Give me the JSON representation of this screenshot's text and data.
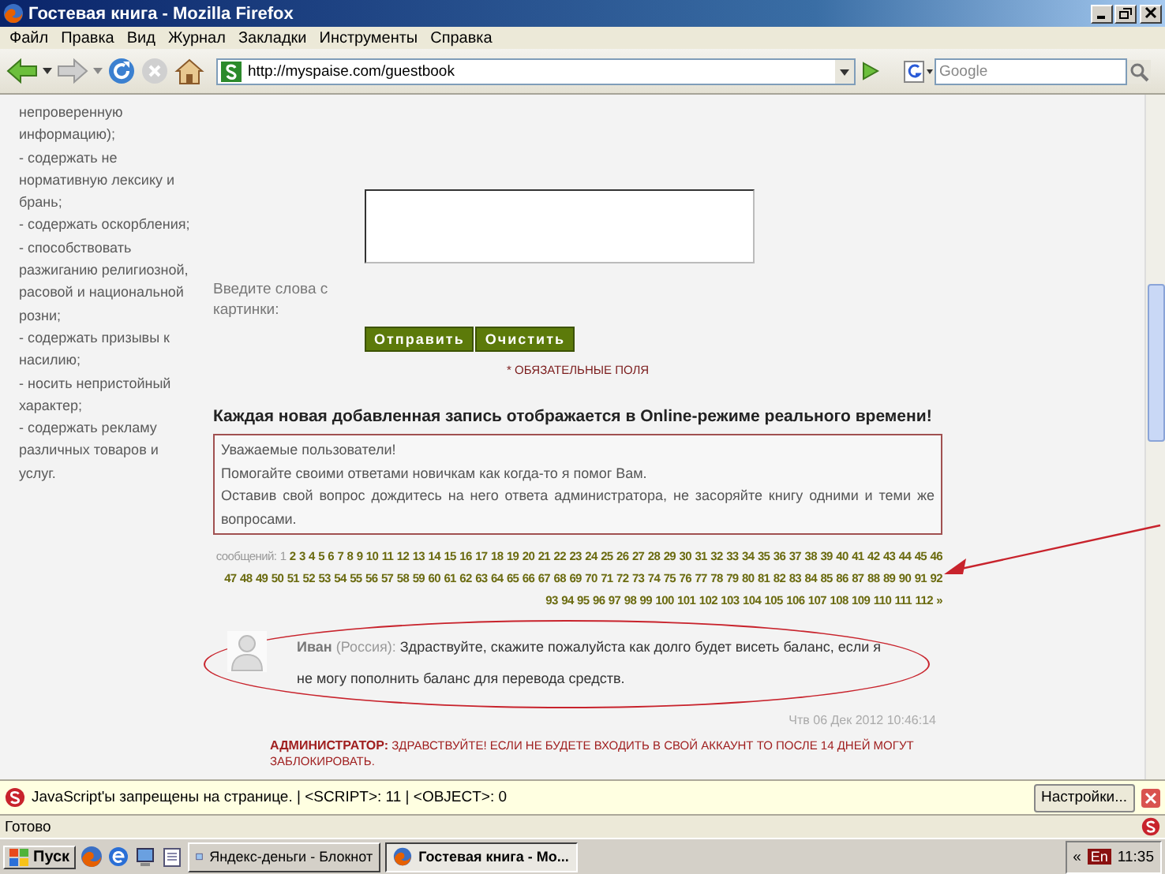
{
  "window": {
    "title": "Гостевая книга - Mozilla Firefox"
  },
  "menu": [
    "Файл",
    "Правка",
    "Вид",
    "Журнал",
    "Закладки",
    "Инструменты",
    "Справка"
  ],
  "navigation": {
    "address": "http://myspaise.com/guestbook",
    "search_placeholder": "Google"
  },
  "sidebar": {
    "rules": [
      "непроверенную информацию);",
      "- содержать не нормативную лексику и брань;",
      "- содержать оскорбления;",
      "- способствовать разжиганию религиозной, расовой и национальной розни;",
      "- содержать призывы к насилию;",
      "- носить непристойный характер;",
      "- содержать рекламу различных товаров и услуг."
    ]
  },
  "form": {
    "captcha_label": "Введите слова с картинки:",
    "buttons": [
      "Отправить",
      "Очистить"
    ],
    "required_note": "* ОБЯЗАТЕЛЬНЫЕ ПОЛЯ"
  },
  "heading": "Каждая новая добавленная запись отображается в Online-режиме реального времени!",
  "notice": [
    "Уважаемые пользователи!",
    "Помогайте своими ответами новичкам как когда-то я помог Вам.",
    "Оставив свой вопрос дождитесь на него ответа администратора, не засоряйте книгу одними и теми же вопросами."
  ],
  "pagination": {
    "label": "сообщений:",
    "pages": [
      {
        "label": "1",
        "selected": true
      },
      {
        "label": "2",
        "selected": false
      },
      {
        "label": "3",
        "selected": false
      },
      {
        "label": "4",
        "selected": false
      },
      {
        "label": "5",
        "selected": false
      },
      {
        "label": "6",
        "selected": false
      },
      {
        "label": "7",
        "selected": false
      },
      {
        "label": "8",
        "selected": false
      },
      {
        "label": "9",
        "selected": false
      },
      {
        "label": "10",
        "selected": false
      },
      {
        "label": "11",
        "selected": false
      },
      {
        "label": "12",
        "selected": false
      },
      {
        "label": "13",
        "selected": false
      },
      {
        "label": "14",
        "selected": false
      },
      {
        "label": "15",
        "selected": false
      },
      {
        "label": "16",
        "selected": false
      },
      {
        "label": "17",
        "selected": false
      },
      {
        "label": "18",
        "selected": false
      },
      {
        "label": "19",
        "selected": false
      },
      {
        "label": "20",
        "selected": false
      },
      {
        "label": "21",
        "selected": false
      },
      {
        "label": "22",
        "selected": false
      },
      {
        "label": "23",
        "selected": false
      },
      {
        "label": "24",
        "selected": false
      },
      {
        "label": "25",
        "selected": false
      },
      {
        "label": "26",
        "selected": false
      },
      {
        "label": "27",
        "selected": false
      },
      {
        "label": "28",
        "selected": false
      },
      {
        "label": "29",
        "selected": false
      },
      {
        "label": "30",
        "selected": false
      },
      {
        "label": "31",
        "selected": false
      },
      {
        "label": "32",
        "selected": false
      },
      {
        "label": "33",
        "selected": false
      },
      {
        "label": "34",
        "selected": false
      },
      {
        "label": "35",
        "selected": false
      },
      {
        "label": "36",
        "selected": false
      },
      {
        "label": "37",
        "selected": false
      },
      {
        "label": "38",
        "selected": false
      },
      {
        "label": "39",
        "selected": false
      },
      {
        "label": "40",
        "selected": false
      },
      {
        "label": "41",
        "selected": false
      },
      {
        "label": "42",
        "selected": false
      },
      {
        "label": "43",
        "selected": false
      },
      {
        "label": "44",
        "selected": false
      },
      {
        "label": "45",
        "selected": false
      },
      {
        "label": "46",
        "selected": false
      },
      {
        "label": "47",
        "selected": false
      },
      {
        "label": "48",
        "selected": false
      },
      {
        "label": "49",
        "selected": false
      },
      {
        "label": "50",
        "selected": false
      },
      {
        "label": "51",
        "selected": false
      },
      {
        "label": "52",
        "selected": false
      },
      {
        "label": "53",
        "selected": false
      },
      {
        "label": "54",
        "selected": false
      },
      {
        "label": "55",
        "selected": false
      },
      {
        "label": "56",
        "selected": false
      },
      {
        "label": "57",
        "selected": false
      },
      {
        "label": "58",
        "selected": false
      },
      {
        "label": "59",
        "selected": false
      },
      {
        "label": "60",
        "selected": false
      },
      {
        "label": "61",
        "selected": false
      },
      {
        "label": "62",
        "selected": false
      },
      {
        "label": "63",
        "selected": false
      },
      {
        "label": "64",
        "selected": false
      },
      {
        "label": "65",
        "selected": false
      },
      {
        "label": "66",
        "selected": false
      },
      {
        "label": "67",
        "selected": false
      },
      {
        "label": "68",
        "selected": false
      },
      {
        "label": "69",
        "selected": false
      },
      {
        "label": "70",
        "selected": false
      },
      {
        "label": "71",
        "selected": false
      },
      {
        "label": "72",
        "selected": false
      },
      {
        "label": "73",
        "selected": false
      },
      {
        "label": "74",
        "selected": false
      },
      {
        "label": "75",
        "selected": false
      },
      {
        "label": "76",
        "selected": false
      },
      {
        "label": "77",
        "selected": false
      },
      {
        "label": "78",
        "selected": false
      },
      {
        "label": "79",
        "selected": false
      },
      {
        "label": "80",
        "selected": false
      },
      {
        "label": "81",
        "selected": false
      },
      {
        "label": "82",
        "selected": false
      },
      {
        "label": "83",
        "selected": false
      },
      {
        "label": "84",
        "selected": false
      },
      {
        "label": "85",
        "selected": false
      },
      {
        "label": "86",
        "selected": false
      },
      {
        "label": "87",
        "selected": false
      },
      {
        "label": "88",
        "selected": false
      },
      {
        "label": "89",
        "selected": false
      },
      {
        "label": "90",
        "selected": false
      },
      {
        "label": "91",
        "selected": false
      },
      {
        "label": "92",
        "selected": false
      },
      {
        "label": "93",
        "selected": false
      },
      {
        "label": "94",
        "selected": false
      },
      {
        "label": "95",
        "selected": false
      },
      {
        "label": "96",
        "selected": false
      },
      {
        "label": "97",
        "selected": false
      },
      {
        "label": "98",
        "selected": false
      },
      {
        "label": "99",
        "selected": false
      },
      {
        "label": "100",
        "selected": false
      },
      {
        "label": "101",
        "selected": false
      },
      {
        "label": "102",
        "selected": false
      },
      {
        "label": "103",
        "selected": false
      },
      {
        "label": "104",
        "selected": false
      },
      {
        "label": "105",
        "selected": false
      },
      {
        "label": "106",
        "selected": false
      },
      {
        "label": "107",
        "selected": false
      },
      {
        "label": "108",
        "selected": false
      },
      {
        "label": "109",
        "selected": false
      },
      {
        "label": "110",
        "selected": false
      },
      {
        "label": "111",
        "selected": false
      },
      {
        "label": "112",
        "selected": false
      }
    ],
    "next": "»"
  },
  "comment": {
    "author": "Иван",
    "location": "(Россия):",
    "text": "Здраствуйте, скажите пожалуйста как долго будет висеть баланс, если я не могу пополнить баланс для перевода средств.",
    "date": "Чтв 06 Дек 2012 10:46:14",
    "reply_label": "АДМИНИСТРАТОР:",
    "reply": "ЗДРАВСТВУЙТЕ! ЕСЛИ НЕ БУДЕТЕ ВХОДИТЬ В СВОЙ АККАУНТ ТО ПОСЛЕ 14 ДНЕЙ МОГУТ ЗАБЛОКИРОВАТЬ."
  },
  "noscript_bar": {
    "message": "JavaScript'ы запрещены на странице. | <SCRIPT>: 11 | <OBJECT>: 0",
    "button": "Настройки..."
  },
  "status_bar": {
    "text": "Готово"
  },
  "taskbar": {
    "start": "Пуск",
    "tasks": [
      {
        "label": "Яндекс-деньги - Блокнот",
        "selected": false
      },
      {
        "label": "Гостевая книга - Мо...",
        "selected": true
      }
    ],
    "tray_arrows": "«",
    "language": "En",
    "clock": "11:35"
  }
}
